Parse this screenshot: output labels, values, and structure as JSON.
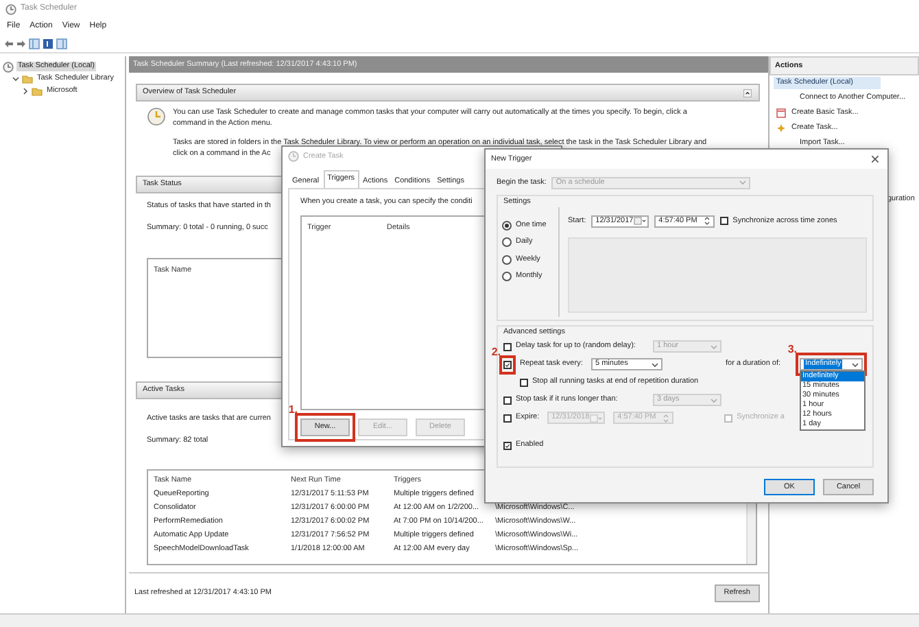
{
  "window": {
    "title": "Task Scheduler"
  },
  "menu": [
    "File",
    "Action",
    "View",
    "Help"
  ],
  "tree": [
    {
      "label": "Task Scheduler (Local)",
      "selected": true,
      "children": [
        {
          "label": "Task Scheduler Library",
          "selected": false,
          "expanded": true,
          "children": [
            {
              "label": "Microsoft",
              "selected": false,
              "expanded": false
            }
          ]
        }
      ]
    }
  ],
  "summary": {
    "title": "Task Scheduler Summary (Last refreshed: 12/31/2017 4:43:10 PM)",
    "overview": {
      "title": "Overview of Task Scheduler",
      "paragraphs": [
        [
          "You can use Task Scheduler to create and manage common tasks that your computer will carry out automatically at the times you specify. To begin, click a",
          "command in the Action menu."
        ],
        [
          "Tasks are stored in folders in the Task Scheduler Library. To view or perform an operation on an individual task, select the task in the Task Scheduler Library and",
          "click on a command in the Ac"
        ]
      ]
    },
    "task_status": {
      "title": "Task Status",
      "lines": [
        "Status of tasks that have started in th",
        "Summary: 0 total - 0 running, 0 succ"
      ],
      "columns": [
        "Task Name"
      ]
    },
    "active_tasks": {
      "title": "Active Tasks",
      "lines": [
        "Active tasks are tasks that are curren",
        "Summary: 82 total"
      ],
      "columns": [
        "Task Name",
        "Next Run Time",
        "Triggers"
      ],
      "rows": [
        [
          "QueueReporting",
          "12/31/2017 5:11:53 PM",
          "Multiple triggers defined"
        ],
        [
          "Consolidator",
          "12/31/2017 6:00:00 PM",
          "At 12:00 AM on 1/2/200...",
          "\\Microsoft\\Windows\\C..."
        ],
        [
          "PerformRemediation",
          "12/31/2017 6:00:02 PM",
          "At 7:00 PM on 10/14/200...",
          "\\Microsoft\\Windows\\W..."
        ],
        [
          "Automatic App Update",
          "12/31/2017 7:56:52 PM",
          "Multiple triggers defined",
          "\\Microsoft\\Windows\\Wi..."
        ],
        [
          "SpeechModelDownloadTask",
          "1/1/2018 12:00:00 AM",
          "At 12:00 AM every day",
          "\\Microsoft\\Windows\\Sp..."
        ]
      ]
    },
    "footer": {
      "text": "Last refreshed at 12/31/2017 4:43:10 PM",
      "button": "Refresh"
    }
  },
  "actions": {
    "title": "Actions",
    "items": [
      {
        "label": "Task Scheduler (Local)",
        "kind": "heading",
        "selected": true
      },
      {
        "label": "Connect to Another Computer...",
        "kind": "plain",
        "selected": false
      },
      {
        "label": "Create Basic Task...",
        "kind": "wizard",
        "selected": false
      },
      {
        "label": "Create Task...",
        "kind": "task",
        "selected": false
      },
      {
        "label": "Import Task...",
        "kind": "plain",
        "selected": false
      }
    ],
    "partial_item": "guration"
  },
  "create_task": {
    "title": "Create Task",
    "tabs": [
      {
        "label": "General",
        "selected": false
      },
      {
        "label": "Triggers",
        "selected": true
      },
      {
        "label": "Actions",
        "selected": false
      },
      {
        "label": "Conditions",
        "selected": false
      },
      {
        "label": "Settings",
        "selected": false
      }
    ],
    "intro": "When you create a task, you can specify the conditi",
    "columns": [
      "Trigger",
      "Details"
    ],
    "buttons": [
      {
        "label": "New...",
        "disabled": false,
        "callout": "1."
      },
      {
        "label": "Edit...",
        "disabled": true
      },
      {
        "label": "Delete",
        "disabled": true
      }
    ]
  },
  "new_trigger": {
    "title": "New Trigger",
    "begin_label": "Begin the task:",
    "begin_value": "On a schedule",
    "settings_title": "Settings",
    "schedule": [
      {
        "label": "One time",
        "selected": true
      },
      {
        "label": "Daily",
        "selected": false
      },
      {
        "label": "Weekly",
        "selected": false
      },
      {
        "label": "Monthly",
        "selected": false
      }
    ],
    "start_label": "Start:",
    "start_date": "12/31/2017",
    "start_time": "4:57:40 PM",
    "sync": {
      "label": "Synchronize across time zones",
      "checked": false
    },
    "advanced_title": "Advanced settings",
    "advanced": [
      {
        "kind": "combo",
        "label": "Delay task for up to (random delay):",
        "checked": false,
        "value": "1 hour",
        "disabled": true
      },
      {
        "kind": "repeat",
        "label": "Repeat task every:",
        "checked": true,
        "value": "5 minutes",
        "callout": "2.",
        "duration_label": "for a duration of:",
        "duration_value": "Indefinitely",
        "duration_callout": "3.",
        "options": [
          {
            "label": "Indefinitely",
            "selected": true
          },
          {
            "label": "15 minutes",
            "selected": false
          },
          {
            "label": "30 minutes",
            "selected": false
          },
          {
            "label": "1 hour",
            "selected": false
          },
          {
            "label": "12 hours",
            "selected": false
          },
          {
            "label": "1 day",
            "selected": false
          }
        ]
      },
      {
        "kind": "subcheck",
        "label": "Stop all running tasks at end of repetition duration",
        "checked": false
      },
      {
        "kind": "combo",
        "label": "Stop task if it runs longer than:",
        "checked": false,
        "value": "3 days",
        "disabled": true
      },
      {
        "kind": "expire",
        "label": "Expire:",
        "checked": false,
        "date": "12/31/2018",
        "time": "4:57:40 PM",
        "sync_label": "Synchronize a",
        "sync_checked": false,
        "disabled": true
      },
      {
        "kind": "check",
        "label": "Enabled",
        "checked": true
      }
    ],
    "buttons": [
      {
        "label": "OK",
        "default": true
      },
      {
        "label": "Cancel",
        "default": false
      }
    ]
  }
}
